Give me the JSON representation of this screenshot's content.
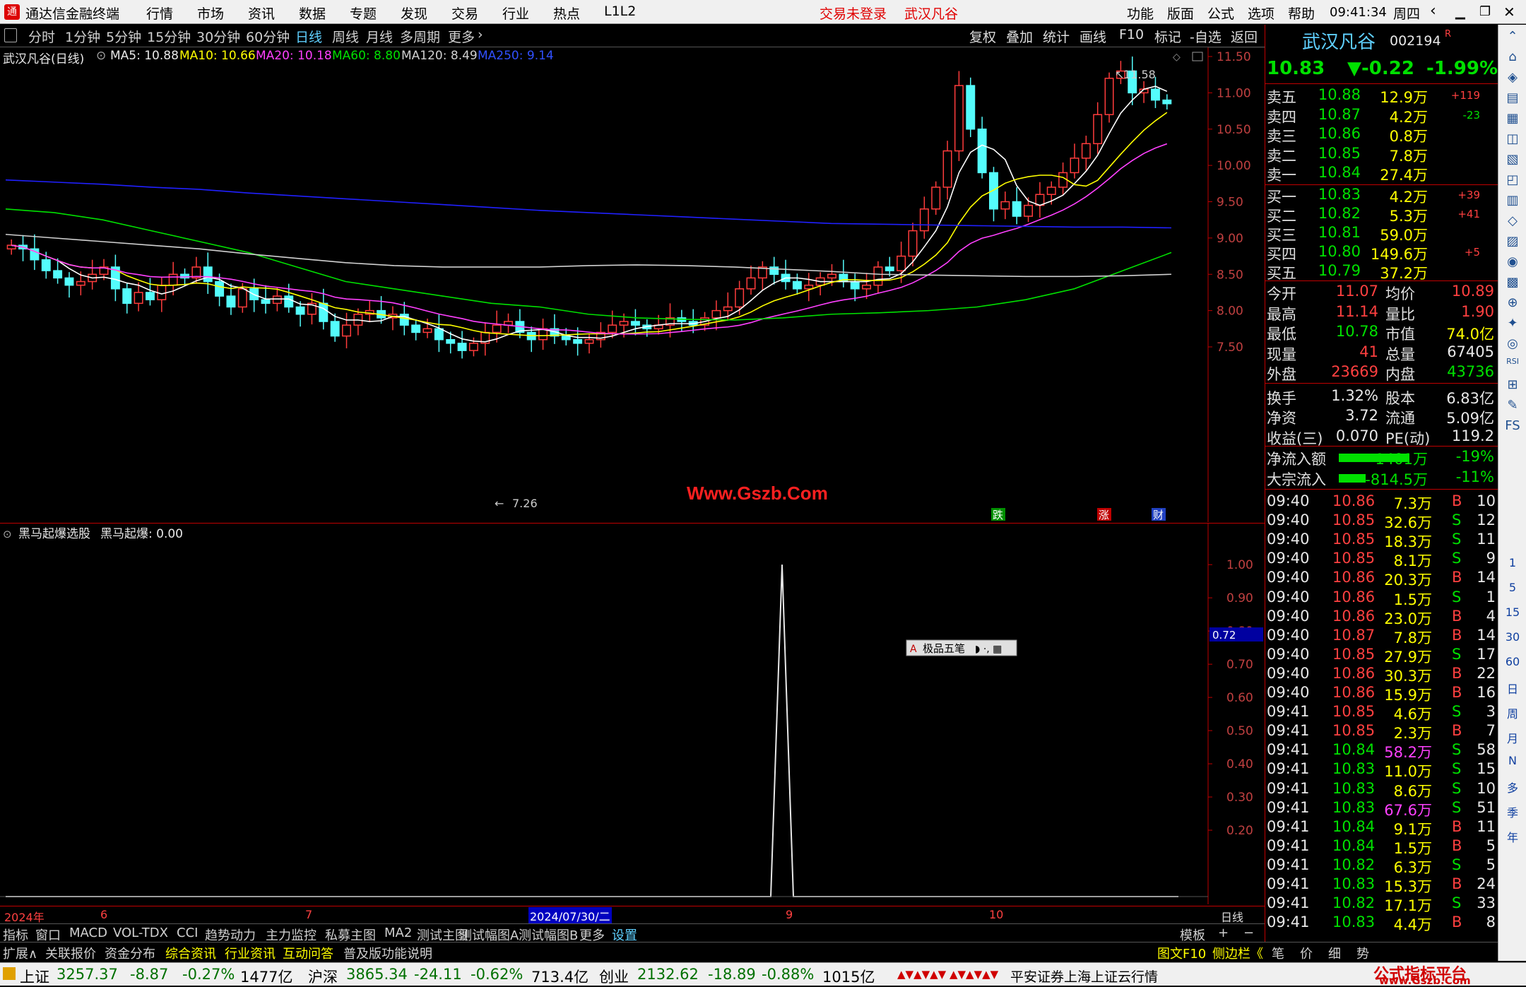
{
  "titlebar": {
    "app": "通达信金融终端",
    "menus": [
      "行情",
      "市场",
      "资讯",
      "数据",
      "专题",
      "发现",
      "交易",
      "行业",
      "热点",
      "L1L2"
    ],
    "login": "交易未登录",
    "stock": "武汉凡谷",
    "right_menus": [
      "功能",
      "版面",
      "公式",
      "选项",
      "帮助"
    ],
    "time": "09:41:34",
    "weekday": "周四"
  },
  "periods": [
    "分时",
    "1分钟",
    "5分钟",
    "15分钟",
    "30分钟",
    "60分钟",
    "日线",
    "周线",
    "月线",
    "多周期",
    "更多"
  ],
  "tools": [
    "复权",
    "叠加",
    "统计",
    "画线",
    "F10",
    "标记",
    "-自选",
    "返回"
  ],
  "main": {
    "name": "武汉凡谷(日线)",
    "ma5": "MA5: 10.88",
    "ma10": "MA10: 10.66",
    "ma20": "MA20: 10.18",
    "ma60": "MA60: 8.80",
    "ma120": "MA120: 8.49",
    "ma250": "MA250: 9.14",
    "high_label": "11.58",
    "low_label": "7.26",
    "watermark": "Www.Gszb.Com",
    "marks": [
      "跌",
      "涨",
      "财"
    ],
    "colors": {
      "ma5": "#ffffff",
      "ma10": "#ffff00",
      "ma20": "#ff40ff",
      "ma60": "#00e000",
      "ma120": "#d0d0d0",
      "ma250": "#2020ff"
    }
  },
  "price_axis": [
    "11.50",
    "11.00",
    "10.50",
    "10.00",
    "9.50",
    "9.00",
    "8.50",
    "8.00",
    "7.50"
  ],
  "sub": {
    "name": "黑马起爆选股",
    "indicator": "黑马起爆: 0.00",
    "axis": [
      "1.00",
      "0.90",
      "0.80",
      "0.70",
      "0.60",
      "0.50",
      "0.40",
      "0.30",
      "0.20"
    ],
    "cursor_value": "0.72",
    "ime": "极品五笔"
  },
  "dates": [
    "2024年",
    "6",
    "7",
    "2024/07/30/二",
    "9",
    "10"
  ],
  "period_label": "日线",
  "chart_data": {
    "type": "line",
    "title": "黑马起爆",
    "x": [
      "2024/08/30"
    ],
    "values": [
      1.0
    ],
    "ylim": [
      0,
      1.0
    ]
  },
  "quote": {
    "name": "武汉凡谷",
    "code": "002194",
    "badge": "R",
    "price": "10.83",
    "change": "▼-0.22",
    "pct": "-1.99%",
    "asks": [
      [
        "卖五",
        "10.88",
        "12.9万",
        "+119"
      ],
      [
        "卖四",
        "10.87",
        "4.2万",
        "-23"
      ],
      [
        "卖三",
        "10.86",
        "0.8万",
        ""
      ],
      [
        "卖二",
        "10.85",
        "7.8万",
        ""
      ],
      [
        "卖一",
        "10.84",
        "27.4万",
        ""
      ]
    ],
    "bids": [
      [
        "买一",
        "10.83",
        "4.2万",
        "+39"
      ],
      [
        "买二",
        "10.82",
        "5.3万",
        "+41"
      ],
      [
        "买三",
        "10.81",
        "59.0万",
        ""
      ],
      [
        "买四",
        "10.80",
        "149.6万",
        "+5"
      ],
      [
        "买五",
        "10.79",
        "37.2万",
        ""
      ]
    ],
    "stats": [
      [
        "今开",
        "11.07",
        "均价",
        "10.89"
      ],
      [
        "最高",
        "11.14",
        "量比",
        "1.90"
      ],
      [
        "最低",
        "10.78",
        "市值",
        "74.0亿"
      ],
      [
        "现量",
        "41",
        "总量",
        "67405"
      ],
      [
        "外盘",
        "23669",
        "内盘",
        "43736"
      ],
      [
        "换手",
        "1.32%",
        "股本",
        "6.83亿"
      ],
      [
        "净资",
        "3.72",
        "流通",
        "5.09亿"
      ],
      [
        "收益(三)",
        "0.070",
        "PE(动)",
        "119.2"
      ]
    ],
    "flows": [
      [
        "净流入额",
        "-1401万",
        "-19%"
      ],
      [
        "大宗流入",
        "-814.5万",
        "-11%"
      ]
    ],
    "ticks": [
      [
        "09:40",
        "10.86",
        "7.3万",
        "B",
        "10"
      ],
      [
        "09:40",
        "10.85",
        "32.6万",
        "S",
        "12"
      ],
      [
        "09:40",
        "10.85",
        "18.3万",
        "S",
        "11"
      ],
      [
        "09:40",
        "10.85",
        "8.1万",
        "S",
        "9"
      ],
      [
        "09:40",
        "10.86",
        "20.3万",
        "B",
        "14"
      ],
      [
        "09:40",
        "10.86",
        "1.5万",
        "S",
        "1"
      ],
      [
        "09:40",
        "10.86",
        "23.0万",
        "B",
        "4"
      ],
      [
        "09:40",
        "10.87",
        "7.8万",
        "B",
        "14"
      ],
      [
        "09:40",
        "10.85",
        "27.9万",
        "S",
        "17"
      ],
      [
        "09:40",
        "10.86",
        "30.3万",
        "B",
        "22"
      ],
      [
        "09:40",
        "10.86",
        "15.9万",
        "B",
        "16"
      ],
      [
        "09:41",
        "10.85",
        "4.6万",
        "S",
        "3"
      ],
      [
        "09:41",
        "10.85",
        "2.3万",
        "B",
        "7"
      ],
      [
        "09:41",
        "10.84",
        "58.2万",
        "S",
        "58"
      ],
      [
        "09:41",
        "10.83",
        "11.0万",
        "S",
        "15"
      ],
      [
        "09:41",
        "10.83",
        "8.6万",
        "S",
        "10"
      ],
      [
        "09:41",
        "10.83",
        "67.6万",
        "S",
        "51"
      ],
      [
        "09:41",
        "10.84",
        "9.1万",
        "B",
        "11"
      ],
      [
        "09:41",
        "10.84",
        "1.5万",
        "B",
        "5"
      ],
      [
        "09:41",
        "10.82",
        "6.3万",
        "S",
        "5"
      ],
      [
        "09:41",
        "10.83",
        "15.3万",
        "B",
        "24"
      ],
      [
        "09:41",
        "10.82",
        "17.1万",
        "S",
        "33"
      ],
      [
        "09:41",
        "10.83",
        "4.4万",
        "B",
        "8"
      ]
    ]
  },
  "tabs1": [
    "指标",
    "窗口",
    "MACD",
    "VOL-TDX",
    "CCI",
    "趋势动力",
    "主力监控",
    "私募主图",
    "MA2",
    "测试主图",
    "测试幅图A",
    "测试幅图B",
    "更多",
    "设置",
    "模板"
  ],
  "tabs2": [
    "扩展∧",
    "关联报价",
    "资金分布",
    "综合资讯",
    "行业资讯",
    "互动问答",
    "普及版功能说明"
  ],
  "tabs2_right": [
    "图文F10",
    "侧边栏《",
    "笔",
    "价",
    "细",
    "势"
  ],
  "sidebar_labels": [
    "1",
    "5",
    "15",
    "30",
    "60",
    "日",
    "周",
    "月",
    "N",
    "多",
    "季",
    "年"
  ],
  "status": {
    "sh": "上证",
    "sh_val": "3257.37",
    "sh_chg": "-8.87",
    "sh_pct": "-0.27%",
    "sh_amt": "1477亿",
    "hs": "沪深",
    "hs_val": "3865.34",
    "hs_chg": "-24.11",
    "hs_pct": "-0.62%",
    "hs_amt": "713.4亿",
    "cy": "创业",
    "cy_val": "2132.62",
    "cy_chg": "-18.89",
    "cy_pct": "-0.88%",
    "cy_amt": "1015亿",
    "broker": "平安证券上海上证云行情",
    "brand": "公式指标平台",
    "brand_url": "www.Gszb.Com"
  }
}
